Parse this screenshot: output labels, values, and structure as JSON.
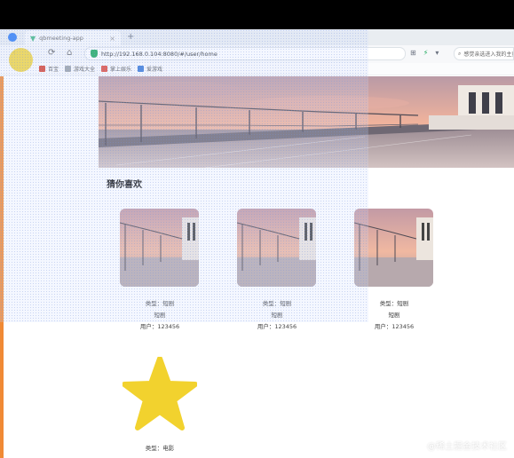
{
  "browser": {
    "tab_title": "qbmeeting-app",
    "new_tab_symbol": "+",
    "close_symbol": "×",
    "url": "http://192.168.0.104:8080/#/user/home",
    "search_placeholder": "感觉亲选进入我的主页",
    "bookmarks": [
      {
        "label": "百宝"
      },
      {
        "label": "游戏大全"
      },
      {
        "label": "掌上娱乐"
      },
      {
        "label": "爱游戏"
      }
    ]
  },
  "page": {
    "section_title": "猜你喜欢",
    "cards": [
      {
        "type_text": "类型：短剧",
        "name": "短剧",
        "user": "用户：123456"
      },
      {
        "type_text": "类型：短剧",
        "name": "短剧",
        "user": "用户：123456"
      },
      {
        "type_text": "类型：短剧",
        "name": "短剧",
        "user": "用户：123456"
      }
    ],
    "lower_type_text": "类型：电影"
  },
  "overlay": {
    "watermark": "@稀土掘金技术社区"
  },
  "colors": {
    "accent_yellow": "#f2d22e",
    "browser_green": "#19a85a",
    "sidebar_orange": "#f08a35"
  },
  "icons": [
    "back-icon",
    "refresh-icon",
    "home-icon",
    "shield-icon",
    "star-icon",
    "search-icon"
  ]
}
